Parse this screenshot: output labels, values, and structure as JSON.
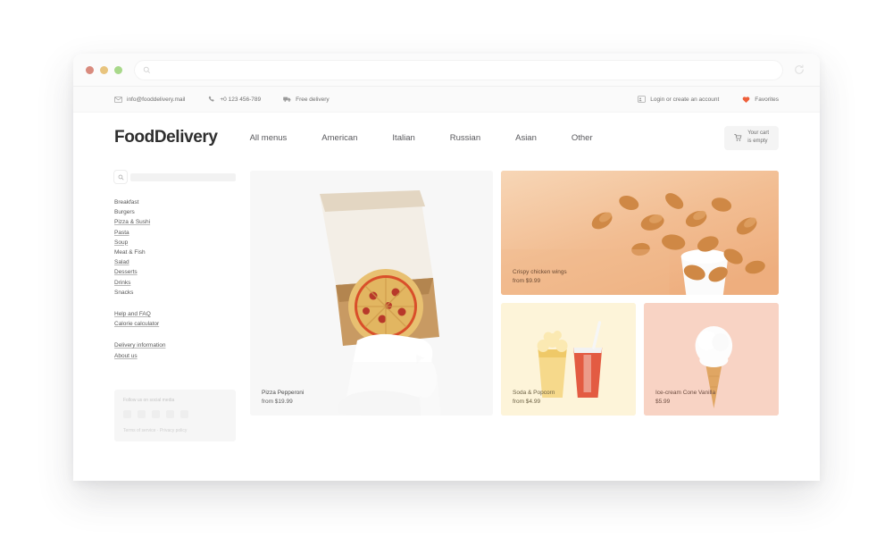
{
  "browser": {
    "address_placeholder": "",
    "reload_icon": "reload-icon",
    "search_icon": "search-icon"
  },
  "topbar": {
    "email": "info@fooddelivery.mail",
    "phone": "+0 123 456-789",
    "delivery": "Free delivery",
    "login": "Login or create an account",
    "favorites": "Favorites",
    "email_icon": "envelope-icon",
    "phone_icon": "phone-icon",
    "delivery_icon": "truck-icon",
    "login_icon": "user-card-icon",
    "favorites_icon": "heart-icon",
    "heart_color": "#ee5f3a"
  },
  "header": {
    "logo": "FoodDelivery",
    "nav": [
      {
        "label": "All menus"
      },
      {
        "label": "American"
      },
      {
        "label": "Italian"
      },
      {
        "label": "Russian"
      },
      {
        "label": "Asian"
      },
      {
        "label": "Other"
      }
    ],
    "cart": {
      "line1": "Your cart",
      "line2": "is empty",
      "icon": "cart-icon"
    }
  },
  "sidebar": {
    "search_placeholder": "",
    "categories": [
      {
        "label": "Breakfast",
        "underlined": false
      },
      {
        "label": "Burgers",
        "underlined": false
      },
      {
        "label": "Pizza & Sushi",
        "underlined": true
      },
      {
        "label": "Pasta",
        "underlined": true
      },
      {
        "label": "Soup",
        "underlined": true
      },
      {
        "label": "Meat & Fish",
        "underlined": false
      },
      {
        "label": "Salad",
        "underlined": true
      },
      {
        "label": "Desserts",
        "underlined": true
      },
      {
        "label": "Drinks",
        "underlined": true
      },
      {
        "label": "Snacks",
        "underlined": false
      }
    ],
    "help_links": [
      {
        "label": "Help and FAQ"
      },
      {
        "label": "Calorie calculator"
      }
    ],
    "info_links": [
      {
        "label": "Delivery information"
      },
      {
        "label": "About us"
      }
    ],
    "promo": {
      "title": "Follow us on social media",
      "footer": "Terms of service  ·  Privacy policy"
    }
  },
  "products": {
    "pizza": {
      "title": "Pizza Pepperoni",
      "price": "from $19.99"
    },
    "wings": {
      "title": "Crispy chicken wings",
      "price": "from $9.99"
    },
    "soda": {
      "title": "Soda & Popcorn",
      "price": "from $4.99"
    },
    "icecream": {
      "title": "Ice-cream Cone Vanilla",
      "price": "$5.99"
    }
  }
}
